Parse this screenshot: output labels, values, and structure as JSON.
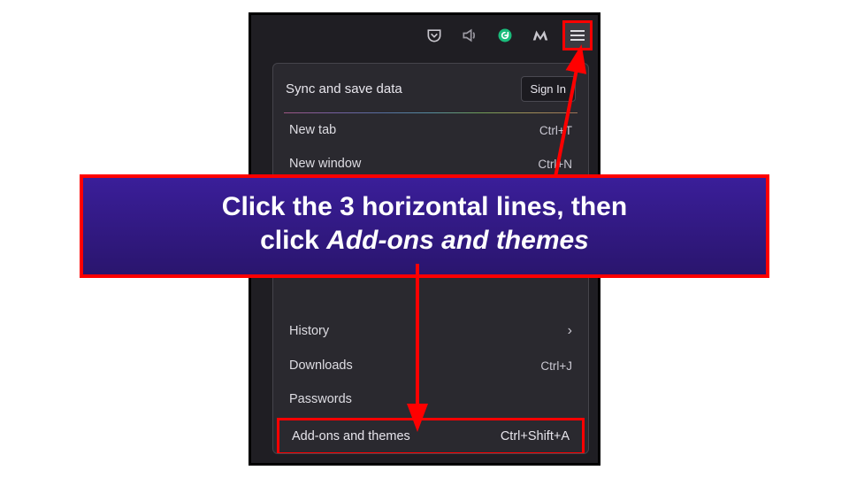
{
  "toolbar": {
    "icons": [
      "pocket",
      "speaker",
      "grammarly",
      "malwarebytes"
    ]
  },
  "menu": {
    "sync_label": "Sync and save data",
    "signin_label": "Sign In",
    "items": [
      {
        "label": "New tab",
        "shortcut": "Ctrl+T"
      },
      {
        "label": "New window",
        "shortcut": "Ctrl+N"
      },
      {
        "label": "History",
        "chevron": true
      },
      {
        "label": "Downloads",
        "shortcut": "Ctrl+J"
      },
      {
        "label": "Passwords"
      },
      {
        "label": "Add-ons and themes",
        "shortcut": "Ctrl+Shift+A"
      }
    ]
  },
  "callout": {
    "line1": "Click the 3 horizontal lines, then",
    "line2_prefix": "click ",
    "line2_italic": "Add-ons and themes"
  },
  "colors": {
    "highlight": "#ff0000",
    "menu_bg": "#2a292f",
    "frame_bg": "#1f1e23",
    "callout_bg_top": "#3a1e99",
    "callout_bg_bottom": "#2a156e"
  }
}
